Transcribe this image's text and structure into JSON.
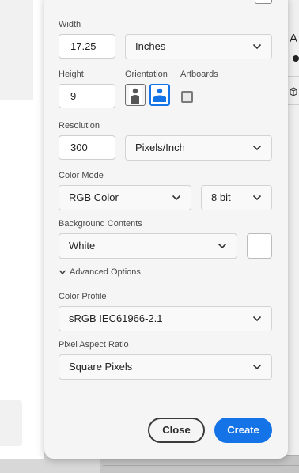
{
  "background": {
    "right_panel_letter": "A"
  },
  "dialog": {
    "width": {
      "label": "Width",
      "value": "17.25",
      "unit": "Inches"
    },
    "height": {
      "label": "Height",
      "value": "9"
    },
    "orientation": {
      "label": "Orientation",
      "selected": "landscape"
    },
    "artboards": {
      "label": "Artboards",
      "checked": false
    },
    "resolution": {
      "label": "Resolution",
      "value": "300",
      "unit": "Pixels/Inch"
    },
    "color_mode": {
      "label": "Color Mode",
      "mode": "RGB Color",
      "depth": "8 bit"
    },
    "background_contents": {
      "label": "Background Contents",
      "value": "White",
      "swatch_color": "#ffffff"
    },
    "advanced_options": {
      "label": "Advanced Options",
      "expanded": true
    },
    "color_profile": {
      "label": "Color Profile",
      "value": "sRGB IEC61966-2.1"
    },
    "pixel_aspect_ratio": {
      "label": "Pixel Aspect Ratio",
      "value": "Square Pixels"
    },
    "buttons": {
      "close": "Close",
      "create": "Create"
    }
  },
  "colors": {
    "accent": "#1473e6",
    "dialog_bg": "#f5f5f5",
    "field_bg": "#ffffff"
  }
}
